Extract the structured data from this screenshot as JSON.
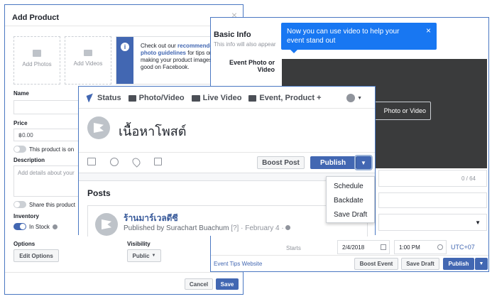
{
  "add_product": {
    "title": "Add Product",
    "close": "×",
    "add_photos": "Add Photos",
    "add_videos": "Add Videos",
    "notice_line1": "Check out our",
    "notice_link": "recommende",
    "notice_line2": "photo guidelines",
    "notice_line3": "for tips on",
    "notice_line4": "making your product images",
    "notice_line5": "good on Facebook.",
    "name_label": "Name",
    "price_label": "Price",
    "price_value": "฿0.00",
    "not_in_stock": "This product is on",
    "description_label": "Description",
    "description_placeholder": "Add details about your",
    "share_product": "Share this product",
    "inventory_label": "Inventory",
    "in_stock": "In Stock",
    "options_label": "Options",
    "edit_options": "Edit Options",
    "visibility_label": "Visibility",
    "visibility_value": "Public",
    "cancel": "Cancel",
    "save": "Save"
  },
  "event": {
    "tooltip": "Now you can use video to help your event stand out",
    "tooltip_close": "×",
    "basic_info": "Basic Info",
    "basic_info_sub": "This info will also appear",
    "event_photo_label": "Event Photo or Video",
    "upload_label": "Photo or Video",
    "char_count": "0 / 64",
    "starts_label": "Starts",
    "date": "2/4/2018",
    "time": "1:00 PM",
    "timezone": "UTC+07",
    "tips_link": "Event Tips Website",
    "boost_event": "Boost Event",
    "save_draft": "Save Draft",
    "publish": "Publish"
  },
  "composer": {
    "tabs": [
      "Status",
      "Photo/Video",
      "Live Video",
      "Event, Product +"
    ],
    "text": "เนื้อหาโพสต์",
    "boost_post": "Boost Post",
    "publish": "Publish",
    "menu": [
      "Schedule",
      "Backdate",
      "Save Draft"
    ],
    "posts_heading": "Posts",
    "page_name": "ร้านมาร์เวลดีซี",
    "published_by": "Published by Surachart Buachum",
    "published_meta": "[?] · February 4 ·"
  },
  "colors": {
    "accent": "#4267b2",
    "tooltip": "#1877f2"
  }
}
